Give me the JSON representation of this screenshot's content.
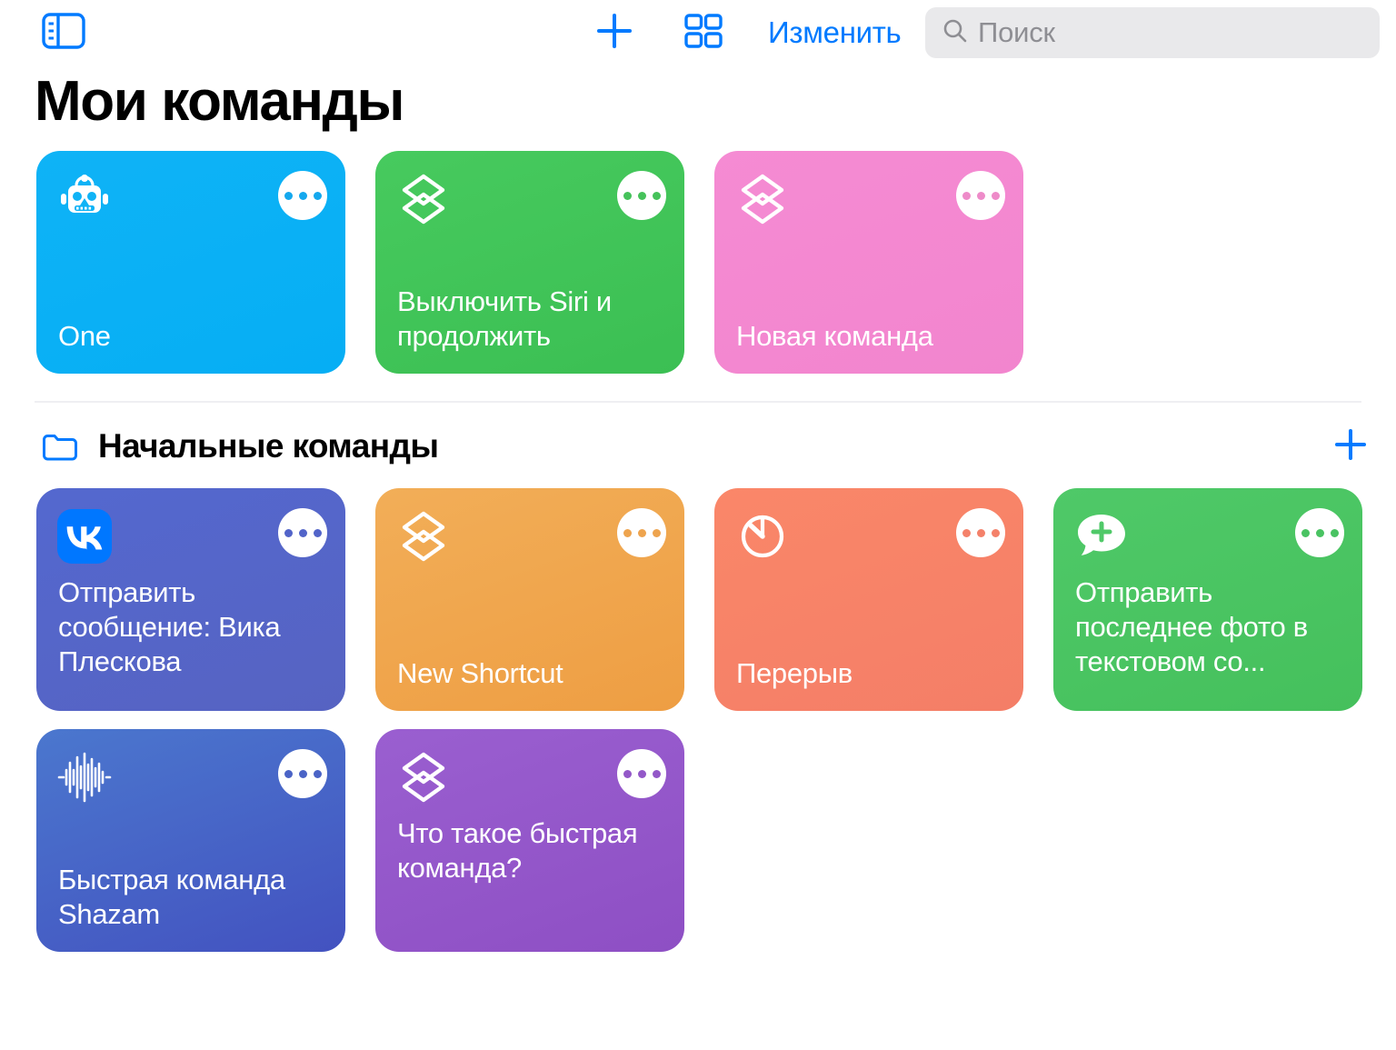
{
  "toolbar": {
    "sidebar_toggle_icon": "sidebar-toggle-icon",
    "add_icon": "plus-icon",
    "grid_icon": "grid-view-icon",
    "edit_label": "Изменить",
    "search_icon": "search-icon",
    "search_placeholder": "Поиск",
    "search_value": ""
  },
  "page": {
    "title": "Мои команды"
  },
  "my_shortcuts": [
    {
      "title": "One",
      "icon": "robot-icon",
      "color_start": "#0FB3F6",
      "color_end": "#06AEF4",
      "menu_tint": "tint-blue",
      "title_position": "bottom"
    },
    {
      "title": "Выключить Siri и продолжить",
      "icon": "layers-icon",
      "color_start": "#47CA5E",
      "color_end": "#3BBF53",
      "menu_tint": "tint-green",
      "title_position": "bottom"
    },
    {
      "title": "Новая команда",
      "icon": "layers-icon",
      "color_start": "#F58BD3",
      "color_end": "#F285CE",
      "menu_tint": "tint-pink",
      "title_position": "bottom"
    }
  ],
  "folder": {
    "icon": "folder-icon",
    "name": "Начальные команды",
    "add_icon": "plus-icon"
  },
  "folder_shortcuts": [
    {
      "title": "Отправить сообщение: Вика Плескова",
      "icon": "vk-icon",
      "color_start": "#5468CF",
      "color_end": "#5663C2",
      "menu_tint": "tint-vk",
      "title_position": "top"
    },
    {
      "title": "New Shortcut",
      "icon": "layers-icon",
      "color_start": "#F2AE58",
      "color_end": "#EE9E43",
      "menu_tint": "tint-orange",
      "title_position": "bottom"
    },
    {
      "title": "Перерыв",
      "icon": "timer-icon",
      "color_start": "#FA8769",
      "color_end": "#F47E67",
      "menu_tint": "tint-salmon",
      "title_position": "bottom"
    },
    {
      "title": "Отправить последнее фото в текстовом со...",
      "icon": "message-plus-icon",
      "color_start": "#4FC968",
      "color_end": "#45C05C",
      "menu_tint": "tint-green2",
      "title_position": "top"
    },
    {
      "title": "Быстрая команда Shazam",
      "icon": "waveform-icon",
      "color_start": "#4B77CE",
      "color_end": "#4352C0",
      "menu_tint": "tint-shazam",
      "title_position": "bottom"
    },
    {
      "title": "Что такое быстрая команда?",
      "icon": "layers-icon",
      "color_start": "#9A5FD0",
      "color_end": "#8E4FC4",
      "menu_tint": "tint-purple",
      "title_position": "top"
    }
  ],
  "colors": {
    "accent": "#007AFF",
    "search_bg": "#E9E9EB",
    "placeholder": "#8E8E93",
    "divider": "#EFEFF2"
  }
}
